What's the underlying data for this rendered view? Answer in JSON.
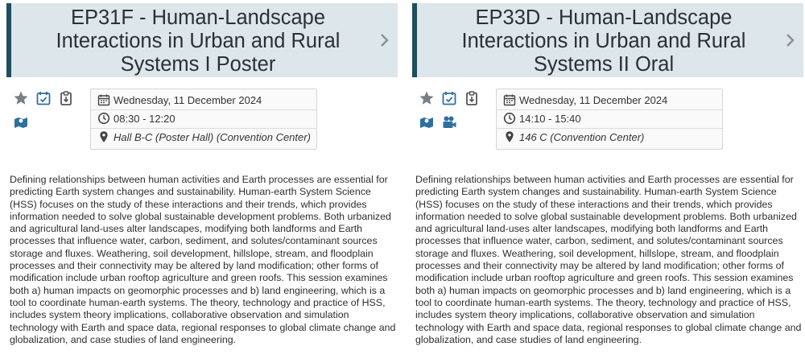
{
  "colors": {
    "header_bg": "#dde6ea",
    "header_accent": "#1f4f5d",
    "icon_grey": "#7a7f85",
    "icon_blue": "#2f6f9f"
  },
  "sessions": [
    {
      "title": "EP31F - Human-Landscape Interactions in Urban and Rural Systems I Poster",
      "date": "Wednesday, 11 December 2024",
      "time": "08:30 - 12:20",
      "location": "Hall B-C (Poster Hall) (Convention Center)",
      "icons": [
        "star-icon",
        "calendar-check-icon",
        "clipboard-icon",
        "map-icon"
      ],
      "description": "Defining relationships between human activities and Earth processes are essential for predicting Earth system changes and sustainability. Human-earth System Science (HSS) focuses on the study of these interactions and their trends, which provides information needed to solve global sustainable development problems. Both urbanized and agricultural land-uses alter landscapes, modifying both landforms and Earth processes that influence water, carbon, sediment, and solutes/contaminant sources storage and fluxes. Weathering, soil development, hillslope, stream, and floodplain processes and their connectivity may be altered by land modification; other forms of modification include urban rooftop agriculture and green roofs. This session examines both a) human impacts on geomorphic processes and b) land engineering, which is a tool to coordinate human-earth systems. The theory, technology and practice of HSS, includes system theory implications, collaborative observation and simulation technology with Earth and space data, regional responses to global climate change and globalization, and case studies of land engineering."
    },
    {
      "title": "EP33D - Human-Landscape Interactions in Urban and Rural Systems II Oral",
      "date": "Wednesday, 11 December 2024",
      "time": "14:10 - 15:40",
      "location": "146 C (Convention Center)",
      "icons": [
        "star-icon",
        "calendar-check-icon",
        "clipboard-icon",
        "map-icon",
        "video-camera-icon"
      ],
      "description": "Defining relationships between human activities and Earth processes are essential for predicting Earth system changes and sustainability. Human-earth System Science (HSS) focuses on the study of these interactions and their trends, which provides information needed to solve global sustainable development problems. Both urbanized and agricultural land-uses alter landscapes, modifying both landforms and Earth processes that influence water, carbon, sediment, and solutes/contaminant sources storage and fluxes. Weathering, soil development, hillslope, stream, and floodplain processes and their connectivity may be altered by land modification; other forms of modification include urban rooftop agriculture and green roofs. This session examines both a) human impacts on geomorphic processes and b) land engineering, which is a tool to coordinate human-earth systems. The theory, technology and practice of HSS, includes system theory implications, collaborative observation and simulation technology with Earth and space data, regional responses to global climate change and globalization, and case studies of land engineering."
    }
  ]
}
